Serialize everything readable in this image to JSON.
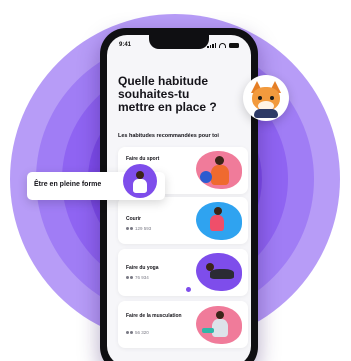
{
  "status_bar": {
    "time": "9:41"
  },
  "screen": {
    "title": "Quelle habitude souhaites-tu mettre en place ?",
    "section_label": "Les habitudes recommandées pour toi"
  },
  "goal_chip": {
    "label": "Être en pleine forme"
  },
  "habits": [
    {
      "title": "Faire du sport",
      "count": ""
    },
    {
      "title": "Courir",
      "count": "129 593"
    },
    {
      "title": "Faire du yoga",
      "count": "76 934"
    },
    {
      "title": "Faire de la musculation",
      "count": "56 320"
    }
  ],
  "colors": {
    "accent": "#7e4deb",
    "card_blob_pink": "#f07b9a",
    "card_blob_blue": "#2fa3f0",
    "card_blob_purple": "#7e4deb"
  }
}
